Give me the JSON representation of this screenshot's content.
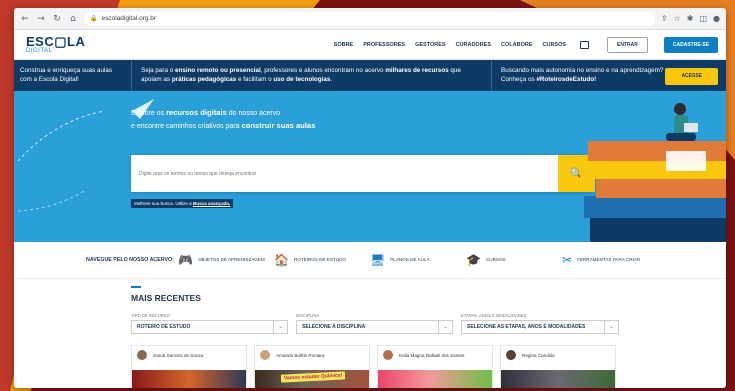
{
  "browser": {
    "url": "escoladigital.org.br",
    "back_glyph": "←",
    "forward_glyph": "→",
    "reload_glyph": "↻",
    "home_glyph": "⌂",
    "lock_glyph": "🔒",
    "extension_glyphs": [
      "⇪",
      "☆",
      "✱",
      "◫",
      "●"
    ]
  },
  "header": {
    "logo_main": "ESC▢LA",
    "logo_sub": "DIGITAL",
    "nav": [
      "SOBRE",
      "PROFESSORES",
      "GESTORES",
      "CURADORES",
      "COLABORE",
      "CURSOS"
    ],
    "login_label": "ENTRAR",
    "signup_label": "CADASTRE-SE"
  },
  "strip": {
    "left_text": "Construa e enriqueça suas aulas com a Escola Digital!",
    "middle_pre": "Seja para o ",
    "middle_b1": "ensino remoto ou presencial",
    "middle_mid1": ", professores e alunos encontram no acervo ",
    "middle_b2": "milhares de recursos",
    "middle_mid2": " que apoiam as ",
    "middle_b3": "práticas pedagógicas",
    "middle_mid3": " e facilitam o ",
    "middle_b4": "uso de tecnologias",
    "middle_end": ".",
    "right_line1": "Buscando mais autonomia no ensino e na aprendizagem?",
    "right_pre": "Conheça os ",
    "right_bold": "#RoteirosdeEstudo!",
    "button_label": "ACESSE"
  },
  "hero": {
    "line1_pre": "Explore os ",
    "line1_bold": "recursos digitais",
    "line1_post": " do nosso acervo",
    "line2_pre": "e encontre caminhos criativos para ",
    "line2_bold": "construir suas aulas",
    "search_placeholder": "Digite aqui os termos ou temas que deseja encontrar",
    "search_icon_glyph": "🔍",
    "advanced_pre": "Melhore sua busca. Utilize a ",
    "advanced_link": "Busca avançada."
  },
  "categories": {
    "label": "NAVEGUE PELO NOSSO ACERVO:",
    "items": [
      {
        "glyph": "🎮",
        "label": "OBJETOS DE APRENDIZAGEM"
      },
      {
        "glyph": "🏠",
        "label": "ROTEIROS DE ESTUDO"
      },
      {
        "glyph": "🖥",
        "label": "PLANOS DE AULA"
      },
      {
        "glyph": "🎓",
        "label": "CURSOS"
      },
      {
        "glyph": "✂",
        "label": "FERRAMENTAS PARA CRIAR"
      }
    ]
  },
  "recent": {
    "title": "MAIS RECENTES",
    "filters": [
      {
        "label": "TIPO DE RECURSO",
        "value": "ROTEIRO DE ESTUDO"
      },
      {
        "label": "DISCIPLINA",
        "value": "SELECIONE A DISCIPLINA"
      },
      {
        "label": "ETAPAS, ANOS E MODALIDADES",
        "value": "SELECIONE AS ETAPAS, ANOS E MODALIDADES"
      }
    ],
    "dropdown_glyph": "⌄",
    "cards": [
      {
        "author": "Josué Samora de Souza"
      },
      {
        "author": "Amanda Bolêlo Pontara",
        "tag": "Vamos estudar Química!"
      },
      {
        "author": "Keila Magna Rafaeli dos Santos"
      },
      {
        "author": "Regina Candido"
      }
    ]
  },
  "colors": {
    "navy": "#0d3b66",
    "hero_blue": "#2b9fd8",
    "accent_yellow": "#f9c80e",
    "link_blue": "#1a7bc7"
  }
}
